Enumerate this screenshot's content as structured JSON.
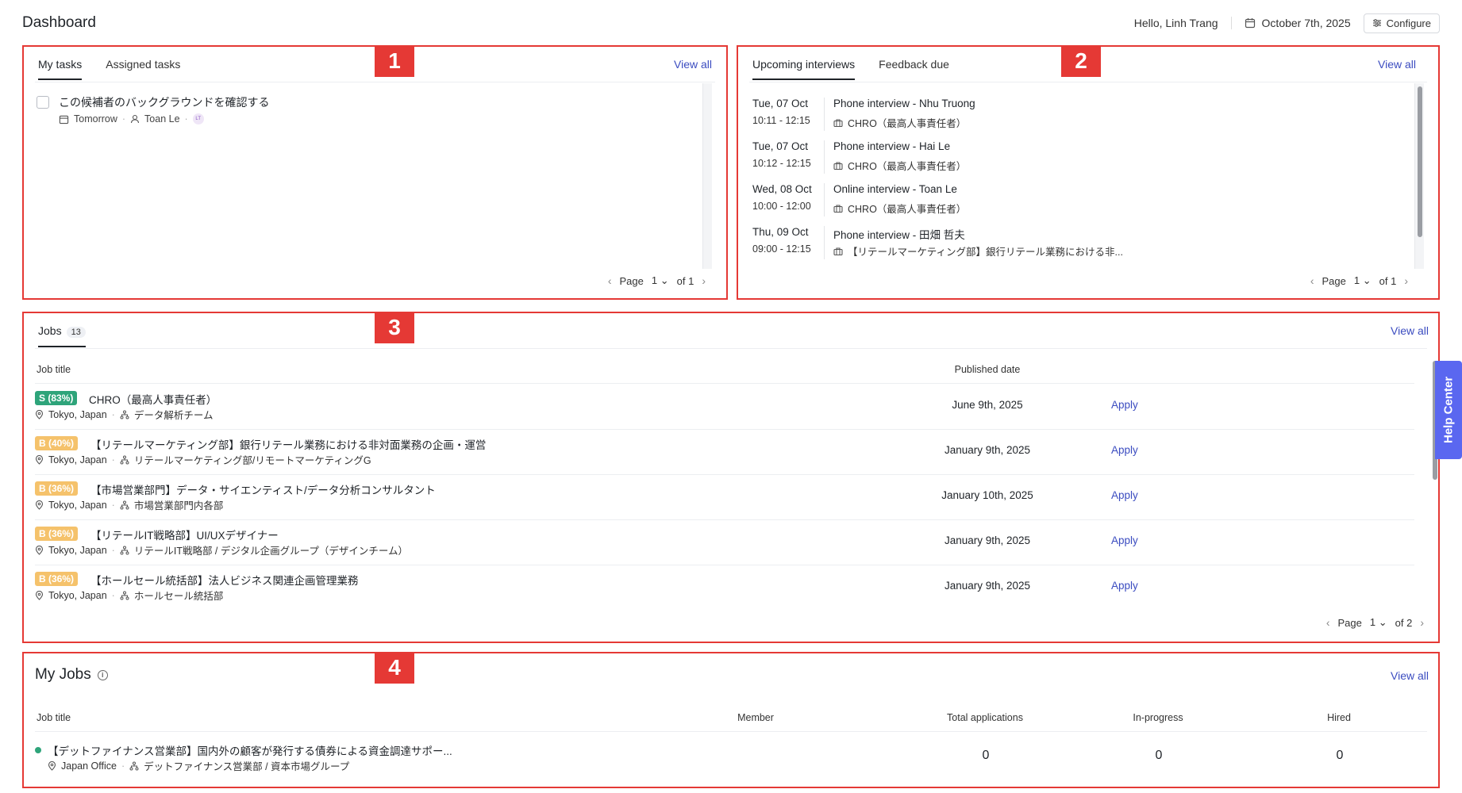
{
  "header": {
    "title": "Dashboard",
    "greeting": "Hello, Linh Trang",
    "date": "October 7th, 2025",
    "configure_label": "Configure"
  },
  "callouts": [
    "1",
    "2",
    "3",
    "4"
  ],
  "tasks_panel": {
    "tabs": [
      {
        "label": "My tasks",
        "active": true
      },
      {
        "label": "Assigned tasks",
        "active": false
      }
    ],
    "view_all": "View all",
    "tasks": [
      {
        "title": "この候補者のバックグラウンドを確認する",
        "due": "Tomorrow",
        "assignee": "Toan Le",
        "avatar": "LT"
      }
    ],
    "pager": {
      "label": "Page",
      "page": "1",
      "of": "of 1"
    }
  },
  "interviews_panel": {
    "tabs": [
      {
        "label": "Upcoming interviews",
        "active": true
      },
      {
        "label": "Feedback due",
        "active": false
      }
    ],
    "view_all": "View all",
    "items": [
      {
        "date": "Tue, 07 Oct",
        "time": "10:11 - 12:15",
        "title": "Phone interview - Nhu Truong",
        "job": "CHRO（最高人事責任者）"
      },
      {
        "date": "Tue, 07 Oct",
        "time": "10:12 - 12:15",
        "title": "Phone interview - Hai Le",
        "job": "CHRO（最高人事責任者）"
      },
      {
        "date": "Wed, 08 Oct",
        "time": "10:00 - 12:00",
        "title": "Online interview - Toan Le",
        "job": "CHRO（最高人事責任者）"
      },
      {
        "date": "Thu, 09 Oct",
        "time": "09:00 - 12:15",
        "title": "Phone interview - 田畑 哲夫",
        "job": "【リテールマーケティング部】銀行リテール業務における非..."
      }
    ],
    "pager": {
      "label": "Page",
      "page": "1",
      "of": "of 1"
    }
  },
  "jobs_panel": {
    "tab": "Jobs",
    "count": "13",
    "view_all": "View all",
    "columns": {
      "title": "Job title",
      "published": "Published date"
    },
    "apply_label": "Apply",
    "rows": [
      {
        "grade": "S (83%)",
        "grade_type": "s",
        "title": "CHRO（最高人事責任者）",
        "location": "Tokyo, Japan",
        "dept": "データ解析チーム",
        "date": "June 9th, 2025"
      },
      {
        "grade": "B (40%)",
        "grade_type": "b",
        "title": "【リテールマーケティング部】銀行リテール業務における非対面業務の企画・運営",
        "location": "Tokyo, Japan",
        "dept": "リテールマーケティング部/リモートマーケティングG",
        "date": "January 9th, 2025"
      },
      {
        "grade": "B (36%)",
        "grade_type": "b",
        "title": "【市場営業部門】データ・サイエンティスト/データ分析コンサルタント",
        "location": "Tokyo, Japan",
        "dept": "市場営業部門内各部",
        "date": "January 10th, 2025"
      },
      {
        "grade": "B (36%)",
        "grade_type": "b",
        "title": "【リテールIT戦略部】UI/UXデザイナー",
        "location": "Tokyo, Japan",
        "dept": "リテールIT戦略部 / デジタル企画グループ（デザインチーム）",
        "date": "January 9th, 2025"
      },
      {
        "grade": "B (36%)",
        "grade_type": "b",
        "title": "【ホールセール統括部】法人ビジネス関連企画管理業務",
        "location": "Tokyo, Japan",
        "dept": "ホールセール統括部",
        "date": "January 9th, 2025"
      }
    ],
    "pager": {
      "label": "Page",
      "page": "1",
      "of": "of 2"
    }
  },
  "my_jobs_panel": {
    "title": "My Jobs",
    "view_all": "View all",
    "columns": {
      "title": "Job title",
      "member": "Member",
      "total": "Total applications",
      "progress": "In-progress",
      "hired": "Hired"
    },
    "rows": [
      {
        "title": "【デットファイナンス営業部】国内外の顧客が発行する債券による資金調達サポー...",
        "location": "Japan Office",
        "dept": "デットファイナンス営業部 / 資本市場グループ",
        "total": "0",
        "progress": "0",
        "hired": "0",
        "status_color": "#2ea47a"
      }
    ]
  },
  "help_center": "Help Center"
}
